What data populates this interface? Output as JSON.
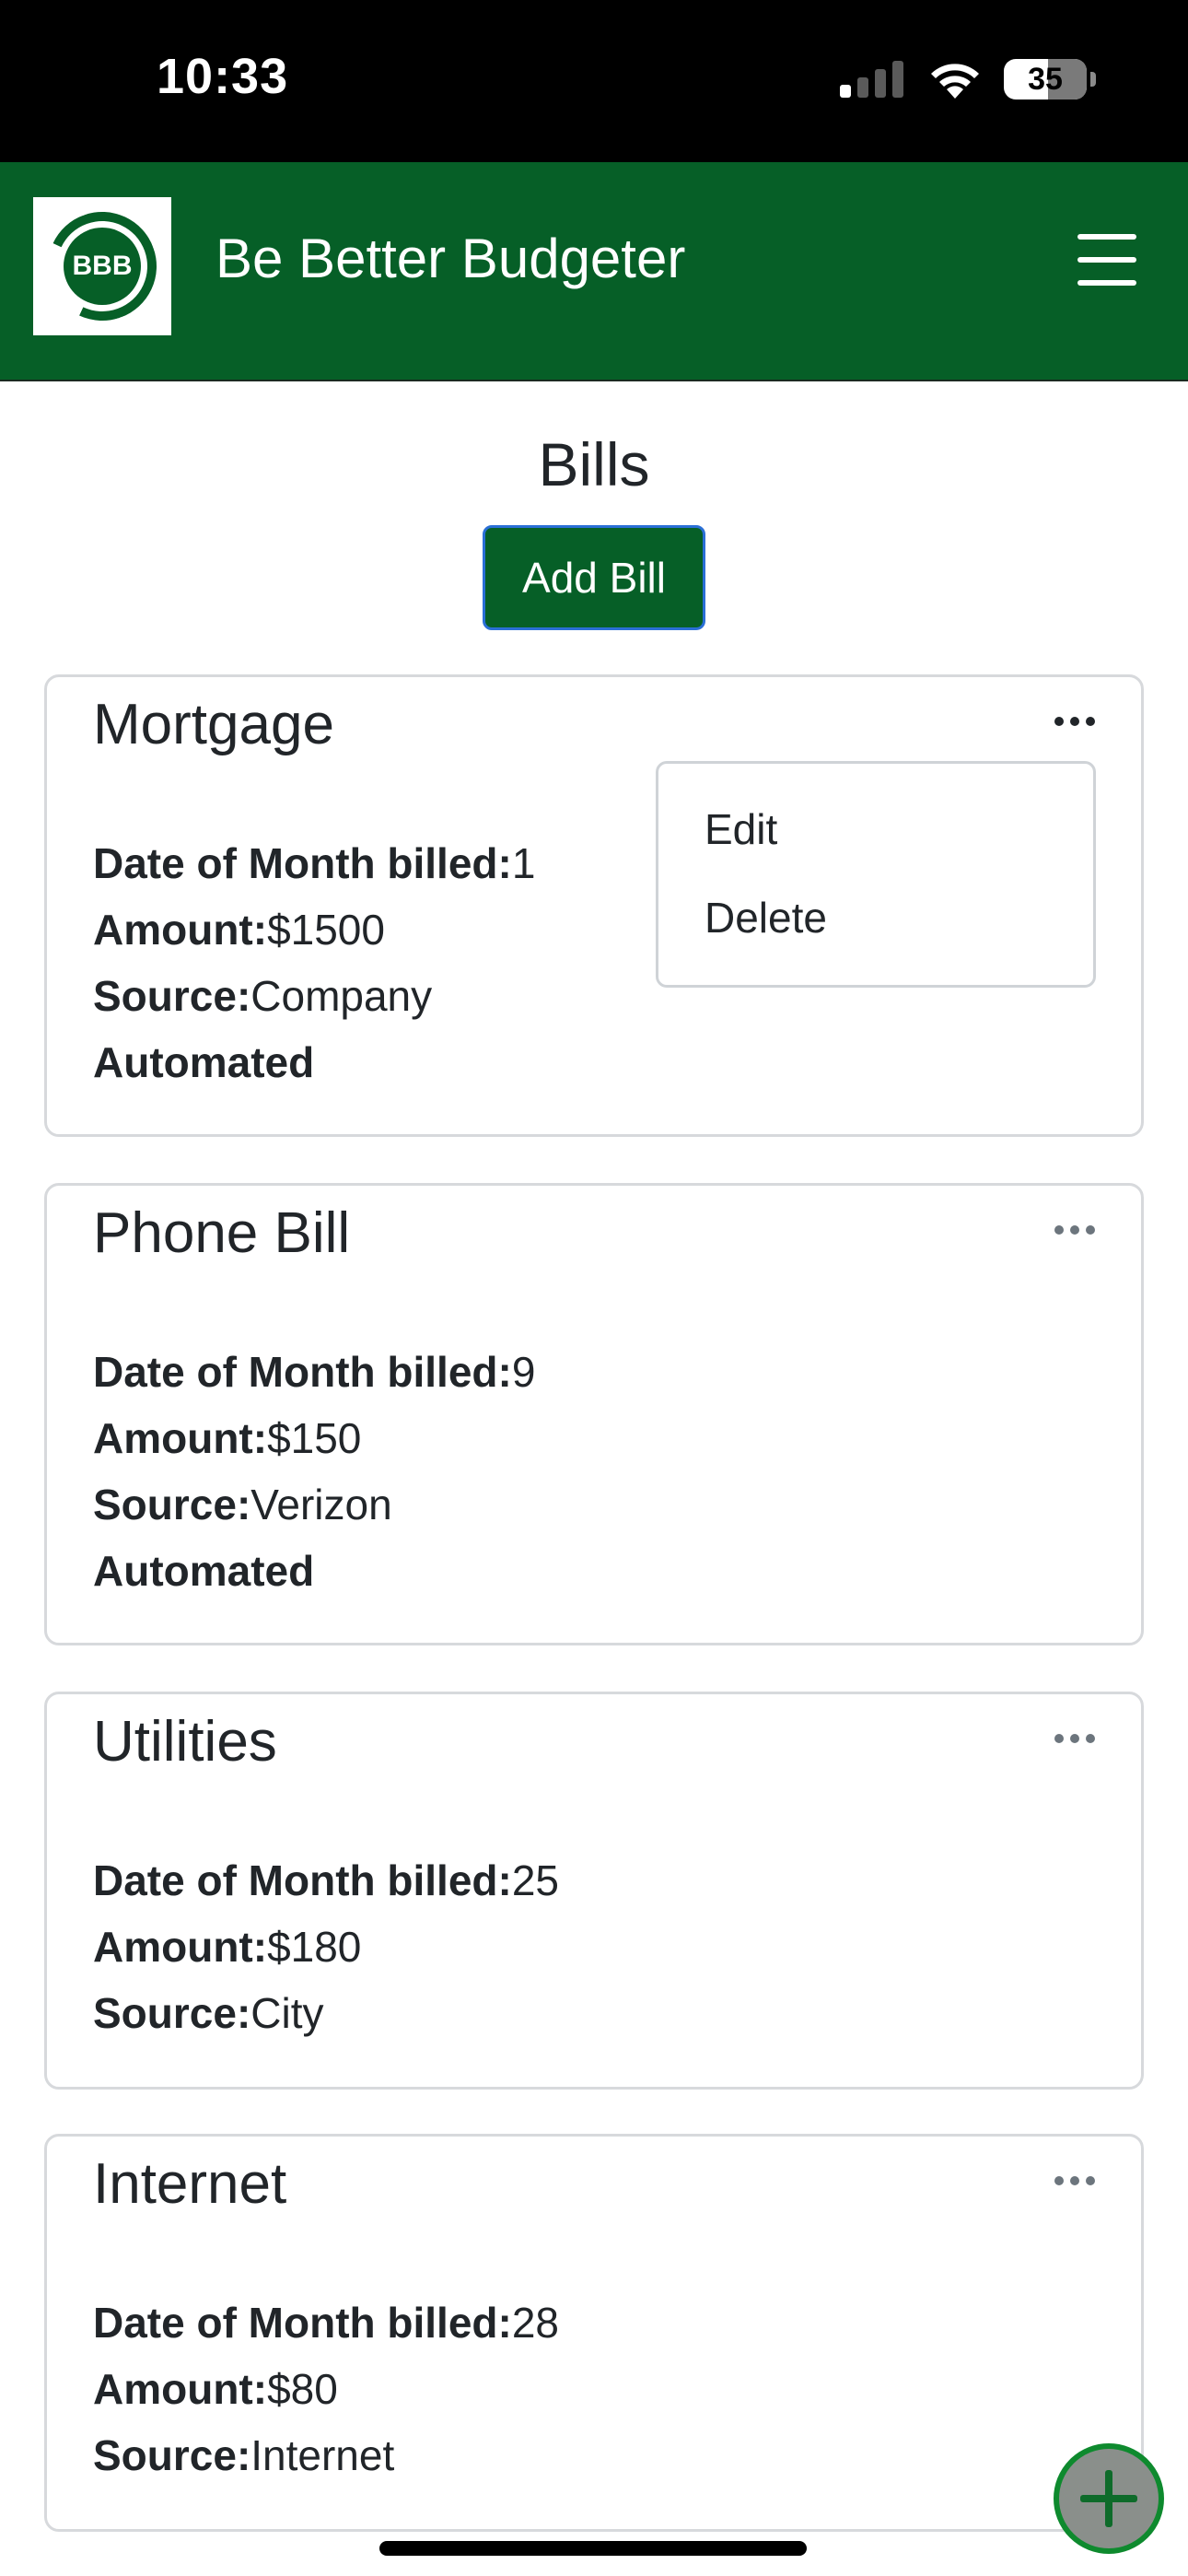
{
  "status_bar": {
    "time": "10:33",
    "battery_percent": "35",
    "signal_icon": "cellular-signal-icon",
    "wifi_icon": "wifi-icon",
    "battery_icon": "battery-icon"
  },
  "navbar": {
    "logo_text": "BBB",
    "title": "Be Better Budgeter",
    "menu_icon": "hamburger-menu-icon",
    "background_color": "#065f27"
  },
  "page": {
    "heading": "Bills",
    "add_button_label": "Add Bill"
  },
  "labels": {
    "date": "Date of Month billed:",
    "amount": "Amount:",
    "source": "Source:",
    "automated": "Automated"
  },
  "bills": [
    {
      "name": "Mortgage",
      "date": "1",
      "amount": "$1500",
      "source": "Company",
      "automated": true
    },
    {
      "name": "Phone Bill",
      "date": "9",
      "amount": "$150",
      "source": "Verizon",
      "automated": true
    },
    {
      "name": "Utilities",
      "date": "25",
      "amount": "$180",
      "source": "City",
      "automated": false
    },
    {
      "name": "Internet",
      "date": "28",
      "amount": "$80",
      "source": "Internet",
      "automated": false
    }
  ],
  "dropdown_menu": {
    "open_for": "Mortgage",
    "items": [
      "Edit",
      "Delete"
    ]
  },
  "fab": {
    "icon": "plus-icon"
  },
  "colors": {
    "brand_green": "#065f27",
    "fab_border": "#0e8a2e"
  }
}
